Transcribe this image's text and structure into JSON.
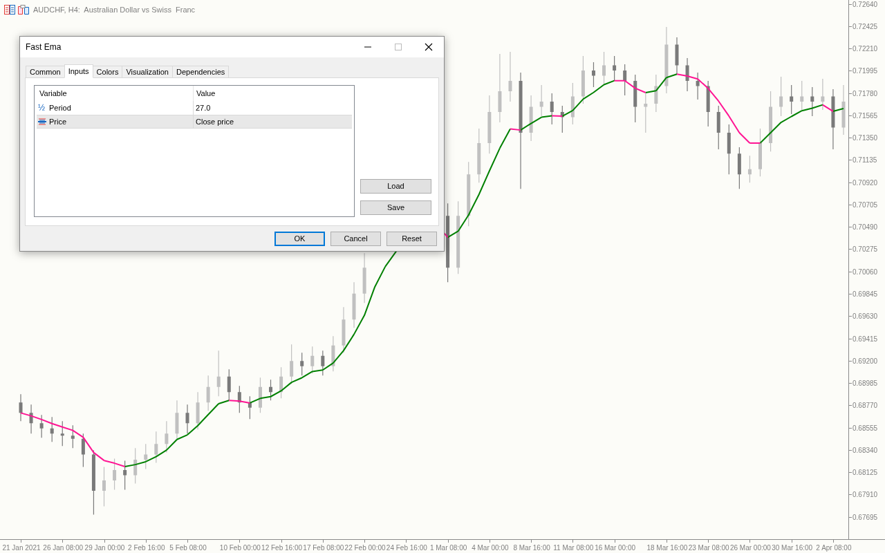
{
  "chart": {
    "title": "AUDCHF, H4:  Australian Dollar vs Swiss  Franc",
    "chart_data": {
      "type": "candlestick",
      "categories": [
        "21 Jan 2021",
        null,
        null,
        null,
        "26 Jan 08:00",
        null,
        null,
        null,
        "29 Jan 00:00",
        null,
        null,
        null,
        "2 Feb 16:00",
        null,
        null,
        null,
        "5 Feb 08:00",
        null,
        null,
        null,
        null,
        "10 Feb 00:00",
        null,
        null,
        null,
        "12 Feb 16:00",
        null,
        null,
        null,
        "17 Feb 08:00",
        null,
        null,
        null,
        "22 Feb 00:00",
        null,
        null,
        null,
        "24 Feb 16:00",
        null,
        null,
        null,
        "1 Mar 08:00",
        null,
        null,
        null,
        "4 Mar 00:00",
        null,
        null,
        null,
        "8 Mar 16:00",
        null,
        null,
        null,
        "11 Mar 08:00",
        null,
        null,
        null,
        "16 Mar 00:00",
        null,
        null,
        null,
        null,
        "18 Mar 16:00",
        null,
        null,
        null,
        "23 Mar 08:00",
        null,
        null,
        null,
        "26 Mar 00:00",
        null,
        null,
        null,
        "30 Mar 16:00",
        null,
        null,
        null,
        "2 Apr 08:00",
        null
      ],
      "ohlc": [
        [
          0.688,
          0.6888,
          0.6862,
          0.687
        ],
        [
          0.687,
          0.6878,
          0.685,
          0.686
        ],
        [
          0.686,
          0.6868,
          0.6846,
          0.6855
        ],
        [
          0.6855,
          0.6866,
          0.6842,
          0.685
        ],
        [
          0.685,
          0.6862,
          0.6838,
          0.6848
        ],
        [
          0.6848,
          0.6858,
          0.6836,
          0.6845
        ],
        [
          0.6845,
          0.685,
          0.6818,
          0.683
        ],
        [
          0.683,
          0.6834,
          0.6772,
          0.6795
        ],
        [
          0.6795,
          0.6818,
          0.678,
          0.6805
        ],
        [
          0.6805,
          0.6826,
          0.6796,
          0.6815
        ],
        [
          0.6815,
          0.6824,
          0.6796,
          0.681
        ],
        [
          0.681,
          0.6836,
          0.6802,
          0.6825
        ],
        [
          0.6825,
          0.684,
          0.6816,
          0.683
        ],
        [
          0.683,
          0.6852,
          0.6822,
          0.684
        ],
        [
          0.684,
          0.6862,
          0.6832,
          0.685
        ],
        [
          0.685,
          0.6882,
          0.6844,
          0.687
        ],
        [
          0.687,
          0.6878,
          0.685,
          0.686
        ],
        [
          0.686,
          0.689,
          0.6854,
          0.688
        ],
        [
          0.688,
          0.6906,
          0.6872,
          0.6895
        ],
        [
          0.6895,
          0.693,
          0.6886,
          0.6905
        ],
        [
          0.6905,
          0.6912,
          0.6882,
          0.689
        ],
        [
          0.689,
          0.6896,
          0.687,
          0.688
        ],
        [
          0.688,
          0.6886,
          0.6864,
          0.6875
        ],
        [
          0.6875,
          0.6904,
          0.687,
          0.6895
        ],
        [
          0.6895,
          0.6902,
          0.6882,
          0.689
        ],
        [
          0.689,
          0.6914,
          0.6884,
          0.6905
        ],
        [
          0.6905,
          0.6936,
          0.6898,
          0.692
        ],
        [
          0.692,
          0.6928,
          0.6906,
          0.6915
        ],
        [
          0.6915,
          0.6934,
          0.6908,
          0.6925
        ],
        [
          0.6925,
          0.693,
          0.6906,
          0.6915
        ],
        [
          0.6915,
          0.6944,
          0.691,
          0.6935
        ],
        [
          0.6935,
          0.6972,
          0.6928,
          0.696
        ],
        [
          0.696,
          0.6996,
          0.6952,
          0.6985
        ],
        [
          0.6985,
          0.7024,
          0.6976,
          0.701
        ],
        null,
        null,
        null,
        null,
        null,
        null,
        null,
        [
          0.706,
          0.7072,
          0.6996,
          0.701
        ],
        [
          0.701,
          0.7074,
          0.7004,
          0.706
        ],
        [
          0.706,
          0.7112,
          0.705,
          0.71
        ],
        [
          0.71,
          0.7144,
          0.7092,
          0.713
        ],
        [
          0.713,
          0.7176,
          0.712,
          0.716
        ],
        [
          0.716,
          0.7216,
          0.715,
          0.718
        ],
        [
          0.718,
          0.7218,
          0.717,
          0.719
        ],
        [
          0.719,
          0.7198,
          0.7086,
          0.714
        ],
        [
          0.714,
          0.7176,
          0.7132,
          0.7165
        ],
        [
          0.7165,
          0.7186,
          0.7156,
          0.717
        ],
        [
          0.717,
          0.7178,
          0.7148,
          0.716
        ],
        [
          0.716,
          0.7166,
          0.714,
          0.7155
        ],
        [
          0.7155,
          0.7188,
          0.7148,
          0.7175
        ],
        [
          0.7175,
          0.7214,
          0.7168,
          0.72
        ],
        [
          0.72,
          0.7208,
          0.7184,
          0.7195
        ],
        [
          0.7195,
          0.7218,
          0.7186,
          0.7205
        ],
        [
          0.7205,
          0.7214,
          0.719,
          0.72
        ],
        [
          0.72,
          0.7206,
          0.7176,
          0.719
        ],
        [
          0.719,
          0.7196,
          0.715,
          0.7165
        ],
        [
          0.7165,
          0.7178,
          0.714,
          0.7168
        ],
        [
          0.7168,
          0.7196,
          0.716,
          0.7185
        ],
        [
          0.7185,
          0.7242,
          0.7178,
          0.7225
        ],
        [
          0.7225,
          0.7232,
          0.7196,
          0.7205
        ],
        [
          0.7205,
          0.7212,
          0.718,
          0.719
        ],
        [
          0.719,
          0.7198,
          0.7172,
          0.7185
        ],
        [
          0.7185,
          0.719,
          0.7146,
          0.716
        ],
        [
          0.716,
          0.7166,
          0.7124,
          0.714
        ],
        [
          0.714,
          0.7148,
          0.71,
          0.712
        ],
        [
          0.712,
          0.7126,
          0.7086,
          0.71
        ],
        [
          0.71,
          0.7118,
          0.7092,
          0.7105
        ],
        [
          0.7105,
          0.7144,
          0.7098,
          0.713
        ],
        [
          0.713,
          0.718,
          0.7122,
          0.7165
        ],
        [
          0.7165,
          0.7194,
          0.7156,
          0.7175
        ],
        [
          0.7175,
          0.7186,
          0.7158,
          0.717
        ],
        [
          0.717,
          0.719,
          0.7162,
          0.7175
        ],
        [
          0.7175,
          0.7184,
          0.7156,
          0.717
        ],
        [
          0.717,
          0.7192,
          0.7162,
          0.7175
        ],
        [
          0.7175,
          0.7182,
          0.7124,
          0.7145
        ],
        [
          0.7145,
          0.7186,
          0.7138,
          0.717
        ]
      ],
      "ylim": [
        0.67483,
        0.7268
      ],
      "yticks": [
        {
          "value": 0.7264,
          "label": "0.72640"
        },
        {
          "value": 0.72425,
          "label": "0.72425"
        },
        {
          "value": 0.7221,
          "label": "0.72210"
        },
        {
          "value": 0.71995,
          "label": "0.71995"
        },
        {
          "value": 0.7178,
          "label": "0.71780"
        },
        {
          "value": 0.71565,
          "label": "0.71565"
        },
        {
          "value": 0.7135,
          "label": "0.71350"
        },
        {
          "value": 0.71135,
          "label": "0.71135"
        },
        {
          "value": 0.7092,
          "label": "0.70920"
        },
        {
          "value": 0.70705,
          "label": "0.70705"
        },
        {
          "value": 0.7049,
          "label": "0.70490"
        },
        {
          "value": 0.70275,
          "label": "0.70275"
        },
        {
          "value": 0.7006,
          "label": "0.70060"
        },
        {
          "value": 0.69845,
          "label": "0.69845"
        },
        {
          "value": 0.6963,
          "label": "0.69630"
        },
        {
          "value": 0.69415,
          "label": "0.69415"
        },
        {
          "value": 0.692,
          "label": "0.69200"
        },
        {
          "value": 0.68985,
          "label": "0.68985"
        },
        {
          "value": 0.6877,
          "label": "0.68770"
        },
        {
          "value": 0.68555,
          "label": "0.68555"
        },
        {
          "value": 0.6834,
          "label": "0.68340"
        },
        {
          "value": 0.68125,
          "label": "0.68125"
        },
        {
          "value": 0.6791,
          "label": "0.67910"
        },
        {
          "value": 0.67695,
          "label": "0.67695"
        }
      ]
    }
  },
  "dialog": {
    "title": "Fast Ema",
    "tabs": [
      {
        "label": "Common",
        "selected": false
      },
      {
        "label": "Inputs",
        "selected": true
      },
      {
        "label": "Colors",
        "selected": false
      },
      {
        "label": "Visualization",
        "selected": false
      },
      {
        "label": "Dependencies",
        "selected": false
      }
    ],
    "columns": [
      "Variable",
      "Value"
    ],
    "rows": [
      {
        "kind": "number",
        "icon": "½",
        "variable": "Period",
        "value": "27.0",
        "selected": false
      },
      {
        "kind": "enum",
        "variable": "Price",
        "value": "Close price",
        "selected": true
      }
    ],
    "side_buttons": [
      "Load",
      "Save"
    ],
    "buttons": [
      {
        "label": "OK",
        "default": true
      },
      {
        "label": "Cancel",
        "default": false
      },
      {
        "label": "Reset",
        "default": false
      }
    ]
  }
}
